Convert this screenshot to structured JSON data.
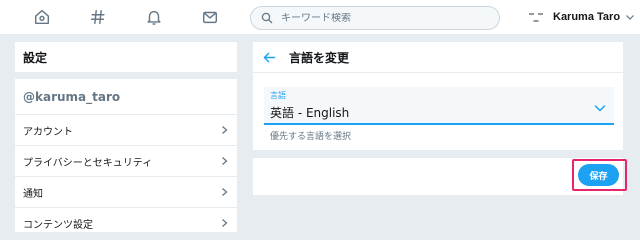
{
  "colors": {
    "accent": "#1da1f2",
    "highlight": "#e8246d",
    "background": "#e6ecf0"
  },
  "nav": {
    "icons": [
      "home-icon",
      "hashtag-icon",
      "bell-icon",
      "mail-icon"
    ]
  },
  "search": {
    "placeholder": "キーワード検索"
  },
  "account": {
    "name": "Karuma Taro"
  },
  "sidebar": {
    "title": "設定",
    "username": "@karuma_taro",
    "items": [
      {
        "label": "アカウント"
      },
      {
        "label": "プライバシーとセキュリティ"
      },
      {
        "label": "通知"
      },
      {
        "label": "コンテンツ設定"
      }
    ]
  },
  "main": {
    "title": "言語を変更",
    "language_field": {
      "label": "言語",
      "value": "英語 - English"
    },
    "hint": "優先する言語を選択",
    "save_label": "保存"
  }
}
